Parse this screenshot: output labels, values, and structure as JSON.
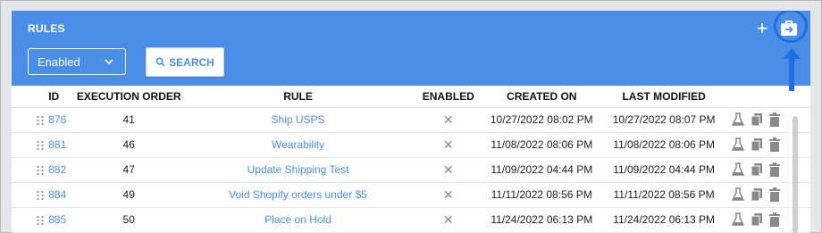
{
  "header": {
    "title": "RULES",
    "filter_value": "Enabled",
    "search_label": "SEARCH",
    "add_label": "+"
  },
  "columns": {
    "id": "ID",
    "execution_order": "EXECUTION ORDER",
    "rule": "RULE",
    "enabled": "ENABLED",
    "created_on": "CREATED ON",
    "last_modified": "LAST MODIFIED"
  },
  "rows": [
    {
      "id": "876",
      "order": "41",
      "rule": "Ship USPS",
      "enabled": "✕",
      "created": "10/27/2022 08:02 PM",
      "modified": "10/27/2022 08:07 PM"
    },
    {
      "id": "881",
      "order": "46",
      "rule": "Wearability",
      "enabled": "✕",
      "created": "11/08/2022 08:06 PM",
      "modified": "11/08/2022 08:06 PM"
    },
    {
      "id": "882",
      "order": "47",
      "rule": "Update Shipping Test",
      "enabled": "✕",
      "created": "11/09/2022 04:44 PM",
      "modified": "11/09/2022 04:44 PM"
    },
    {
      "id": "884",
      "order": "49",
      "rule": "Void Shopify orders under $5",
      "enabled": "✕",
      "created": "11/11/2022 08:56 PM",
      "modified": "11/11/2022 08:56 PM"
    },
    {
      "id": "885",
      "order": "50",
      "rule": "Place on Hold",
      "enabled": "✕",
      "created": "11/24/2022 06:13 PM",
      "modified": "11/24/2022 06:13 PM"
    }
  ],
  "colors": {
    "header_bg": "#4a8ee8",
    "link": "#4a8ee8",
    "highlight": "#1f6fe0"
  },
  "icons": [
    "chevron-down-icon",
    "search-icon",
    "plus-icon",
    "export-icon",
    "drag-handle-icon",
    "close-icon",
    "flask-icon",
    "copy-icon",
    "trash-icon",
    "arrow-up-icon"
  ]
}
